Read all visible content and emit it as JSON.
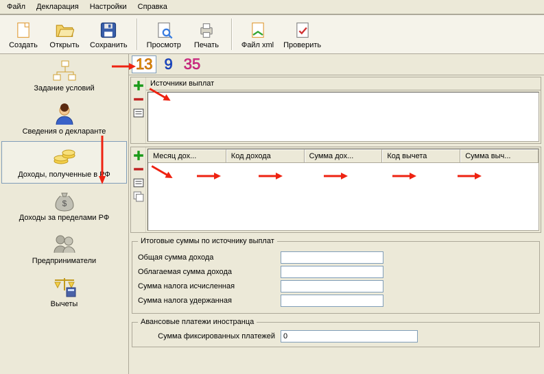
{
  "menu": {
    "file": "Файл",
    "decl": "Декларация",
    "settings": "Настройки",
    "help": "Справка"
  },
  "toolbar": {
    "create": "Создать",
    "open": "Открыть",
    "save": "Сохранить",
    "preview": "Просмотр",
    "print": "Печать",
    "xml": "Файл xml",
    "check": "Проверить"
  },
  "sidebar": {
    "conditions": "Задание условий",
    "declarant": "Сведения о декларанте",
    "income_rf": "Доходы, полученные в РФ",
    "income_abroad": "Доходы за пределами РФ",
    "entrepreneurs": "Предприниматели",
    "deductions": "Вычеты"
  },
  "numbers": {
    "n13": "13",
    "n9": "9",
    "n35": "35"
  },
  "sources": {
    "title": "Источники выплат"
  },
  "grid": {
    "cols": {
      "month": "Месяц дох...",
      "code_inc": "Код дохода",
      "sum_inc": "Сумма дох...",
      "code_ded": "Код вычета",
      "sum_ded": "Сумма выч..."
    }
  },
  "totals": {
    "legend": "Итоговые суммы по источнику выплат",
    "lbl_total": "Общая сумма дохода",
    "lbl_taxable": "Облагаемая сумма дохода",
    "lbl_tax_calc": "Сумма налога исчисленная",
    "lbl_tax_held": "Сумма налога удержанная",
    "val_total": "",
    "val_taxable": "",
    "val_tax_calc": "",
    "val_tax_held": ""
  },
  "advance": {
    "legend": "Авансовые платежи иностранца",
    "lbl_fixed": "Сумма фиксированных платежей",
    "val_fixed": "0"
  }
}
